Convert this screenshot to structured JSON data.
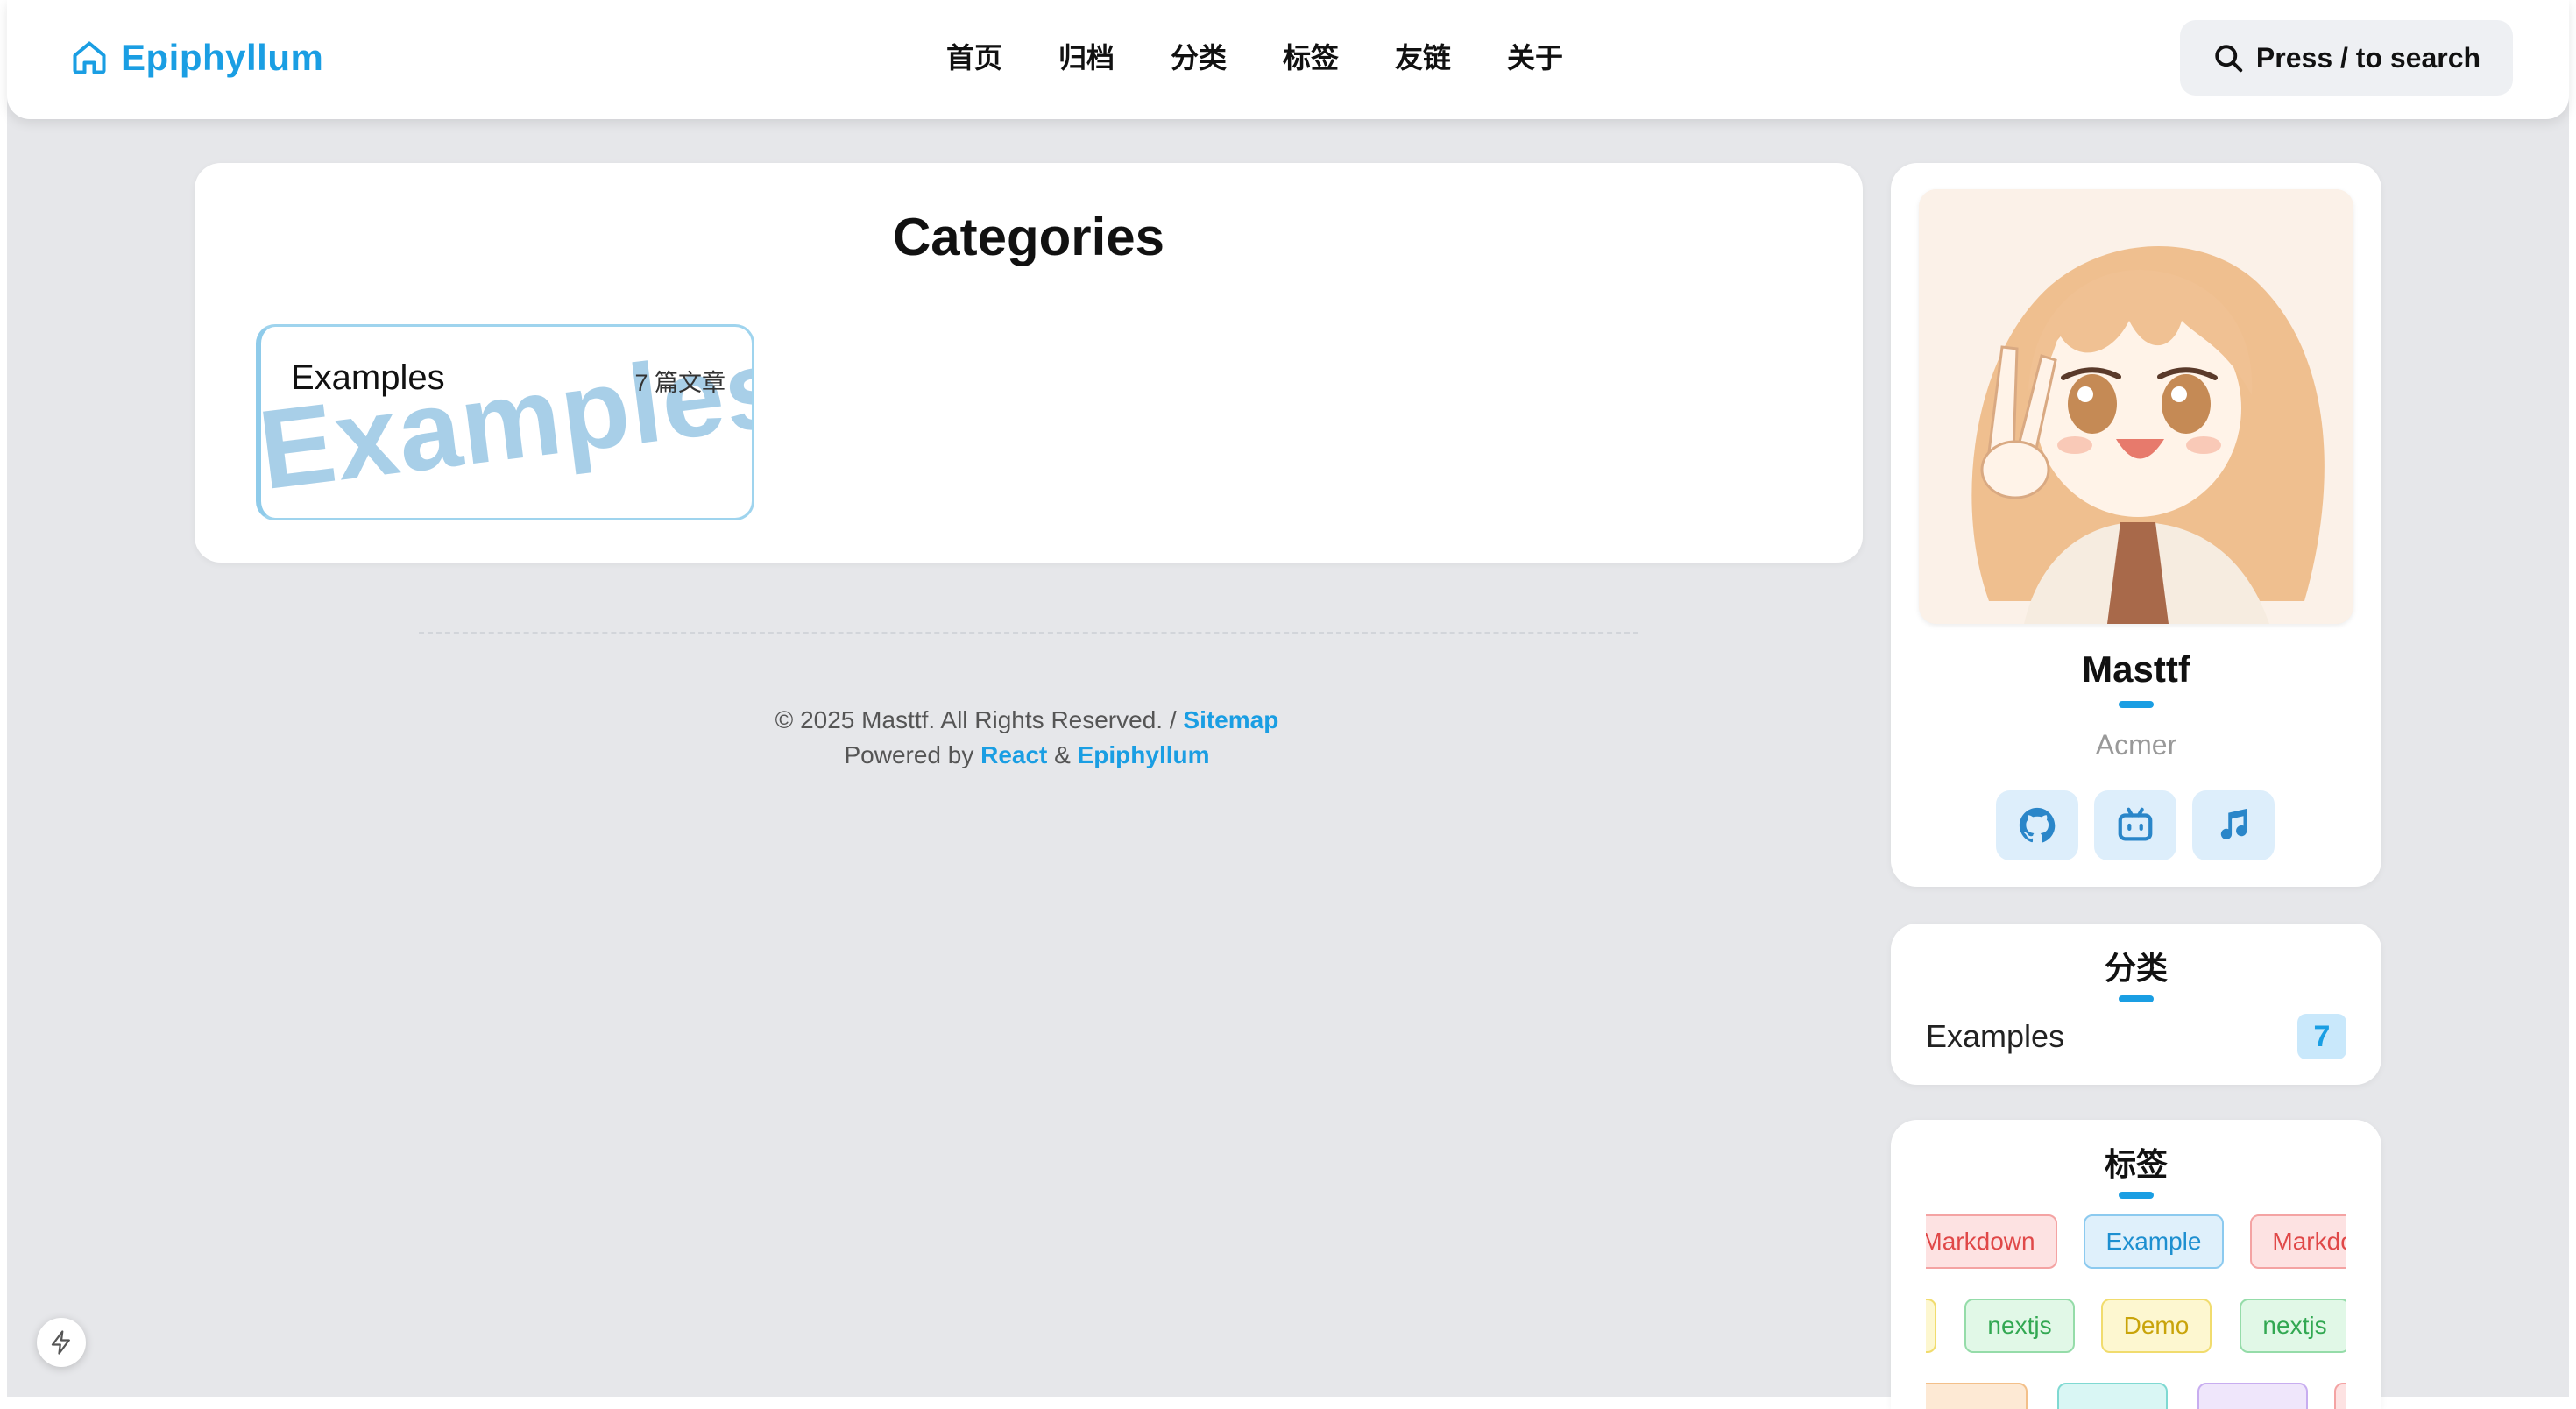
{
  "header": {
    "brand": "Epiphyllum",
    "nav": [
      "首页",
      "归档",
      "分类",
      "标签",
      "友链",
      "关于"
    ],
    "search_label": "Press / to search"
  },
  "main": {
    "title": "Categories",
    "categories": [
      {
        "name": "Examples",
        "count_label": "7 篇文章",
        "watermark": "Examples"
      }
    ]
  },
  "footer": {
    "copyright": "© 2025 Masttf. All Rights Reserved. / ",
    "sitemap": "Sitemap",
    "powered_by": "Powered by ",
    "react": "React",
    "amp": " & ",
    "epiphyllum": "Epiphyllum"
  },
  "sidebar": {
    "profile": {
      "name": "Masttf",
      "role": "Acmer",
      "socials": [
        "github-icon",
        "bilibili-icon",
        "music-icon"
      ]
    },
    "categories": {
      "title": "分类",
      "items": [
        {
          "name": "Examples",
          "count": "7"
        }
      ]
    },
    "tags": {
      "title": "标签",
      "items": [
        {
          "label": "Markdown",
          "color": "red"
        },
        {
          "label": "Example",
          "color": "blue"
        },
        {
          "label": "Markdown",
          "color": "red"
        },
        {
          "label": "nextjs",
          "color": "green"
        },
        {
          "label": "Demo",
          "color": "yellow"
        },
        {
          "label": "nextjs",
          "color": "green"
        }
      ]
    }
  },
  "colors": {
    "accent": "#1a9ee3",
    "background": "#e6e7ea"
  }
}
